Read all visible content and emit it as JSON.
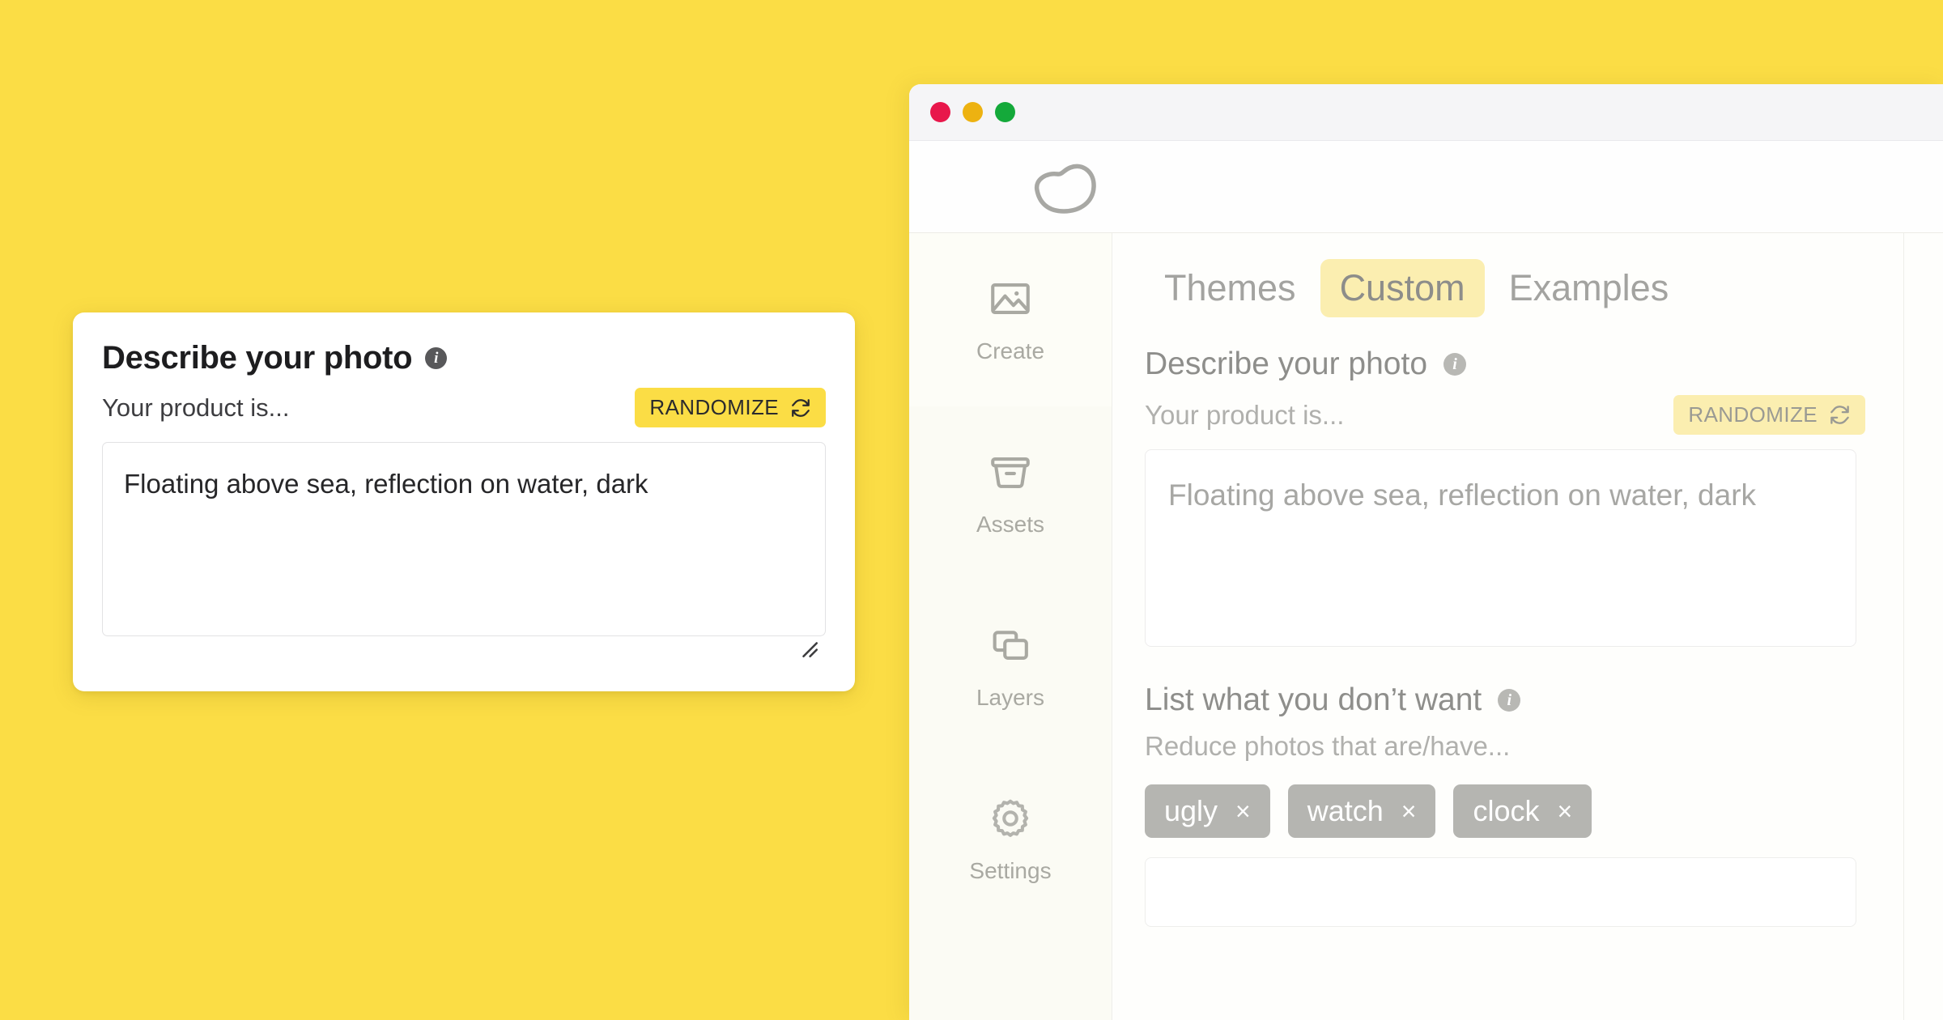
{
  "theme": {
    "background": "#FBDD45",
    "accent_yellow": "#FBDD45",
    "accent_yellow_pale": "#FBEEB0",
    "tag_gray": "#B5B5B1",
    "traffic_red": "#E8174B",
    "traffic_yellow": "#EDB211",
    "traffic_green": "#14A93A"
  },
  "zoom_card": {
    "title": "Describe your photo",
    "info_icon": "info-icon",
    "info_glyph": "i",
    "sub_label": "Your product is...",
    "randomize_label": "RANDOMIZE",
    "randomize_icon": "sync-icon",
    "textarea_value": "Floating above sea, reflection on water, dark",
    "resize_handle": "resize-grip-icon"
  },
  "window": {
    "traffic_lights": [
      "close",
      "minimize",
      "maximize"
    ],
    "logo": "blob-logo"
  },
  "sidebar": {
    "items": [
      {
        "label": "Create",
        "icon": "image-icon",
        "active": true
      },
      {
        "label": "Assets",
        "icon": "basket-icon",
        "active": false
      },
      {
        "label": "Layers",
        "icon": "layers-icon",
        "active": false
      },
      {
        "label": "Settings",
        "icon": "gear-icon",
        "active": false
      }
    ]
  },
  "main": {
    "tabs": [
      {
        "label": "Themes",
        "active": false
      },
      {
        "label": "Custom",
        "active": true
      },
      {
        "label": "Examples",
        "active": false
      }
    ],
    "describe": {
      "title": "Describe your photo",
      "info_glyph": "i",
      "sub_label": "Your product is...",
      "randomize_label": "RANDOMIZE",
      "textarea_value": "Floating above sea, reflection on water, dark"
    },
    "exclude": {
      "title": "List what you don’t want",
      "info_glyph": "i",
      "sub_label": "Reduce photos that are/have...",
      "tags": [
        {
          "label": "ugly",
          "remove": "×"
        },
        {
          "label": "watch",
          "remove": "×"
        },
        {
          "label": "clock",
          "remove": "×"
        }
      ]
    }
  }
}
